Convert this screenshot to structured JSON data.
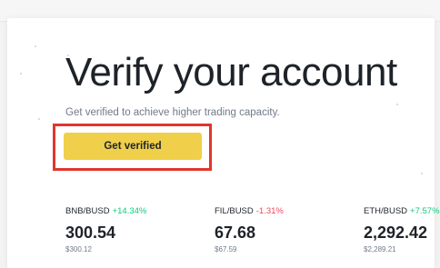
{
  "hero": {
    "title": "Verify your account",
    "subtitle": "Get verified to achieve higher trading capacity.",
    "cta_label": "Get verified"
  },
  "tickers": [
    {
      "pair": "BNB/BUSD",
      "change": "+14.34%",
      "direction": "up",
      "price": "300.54",
      "fiat": "$300.12"
    },
    {
      "pair": "FIL/BUSD",
      "change": "-1.31%",
      "direction": "down",
      "price": "67.68",
      "fiat": "$67.59"
    },
    {
      "pair": "ETH/BUSD",
      "change": "+7.57%",
      "direction": "up",
      "price": "2,292.42",
      "fiat": "$2,289.21"
    }
  ],
  "colors": {
    "accent": "#f0cf4b",
    "positive": "#0ecb81",
    "negative": "#f6465d",
    "highlight_box": "#e0362c"
  }
}
